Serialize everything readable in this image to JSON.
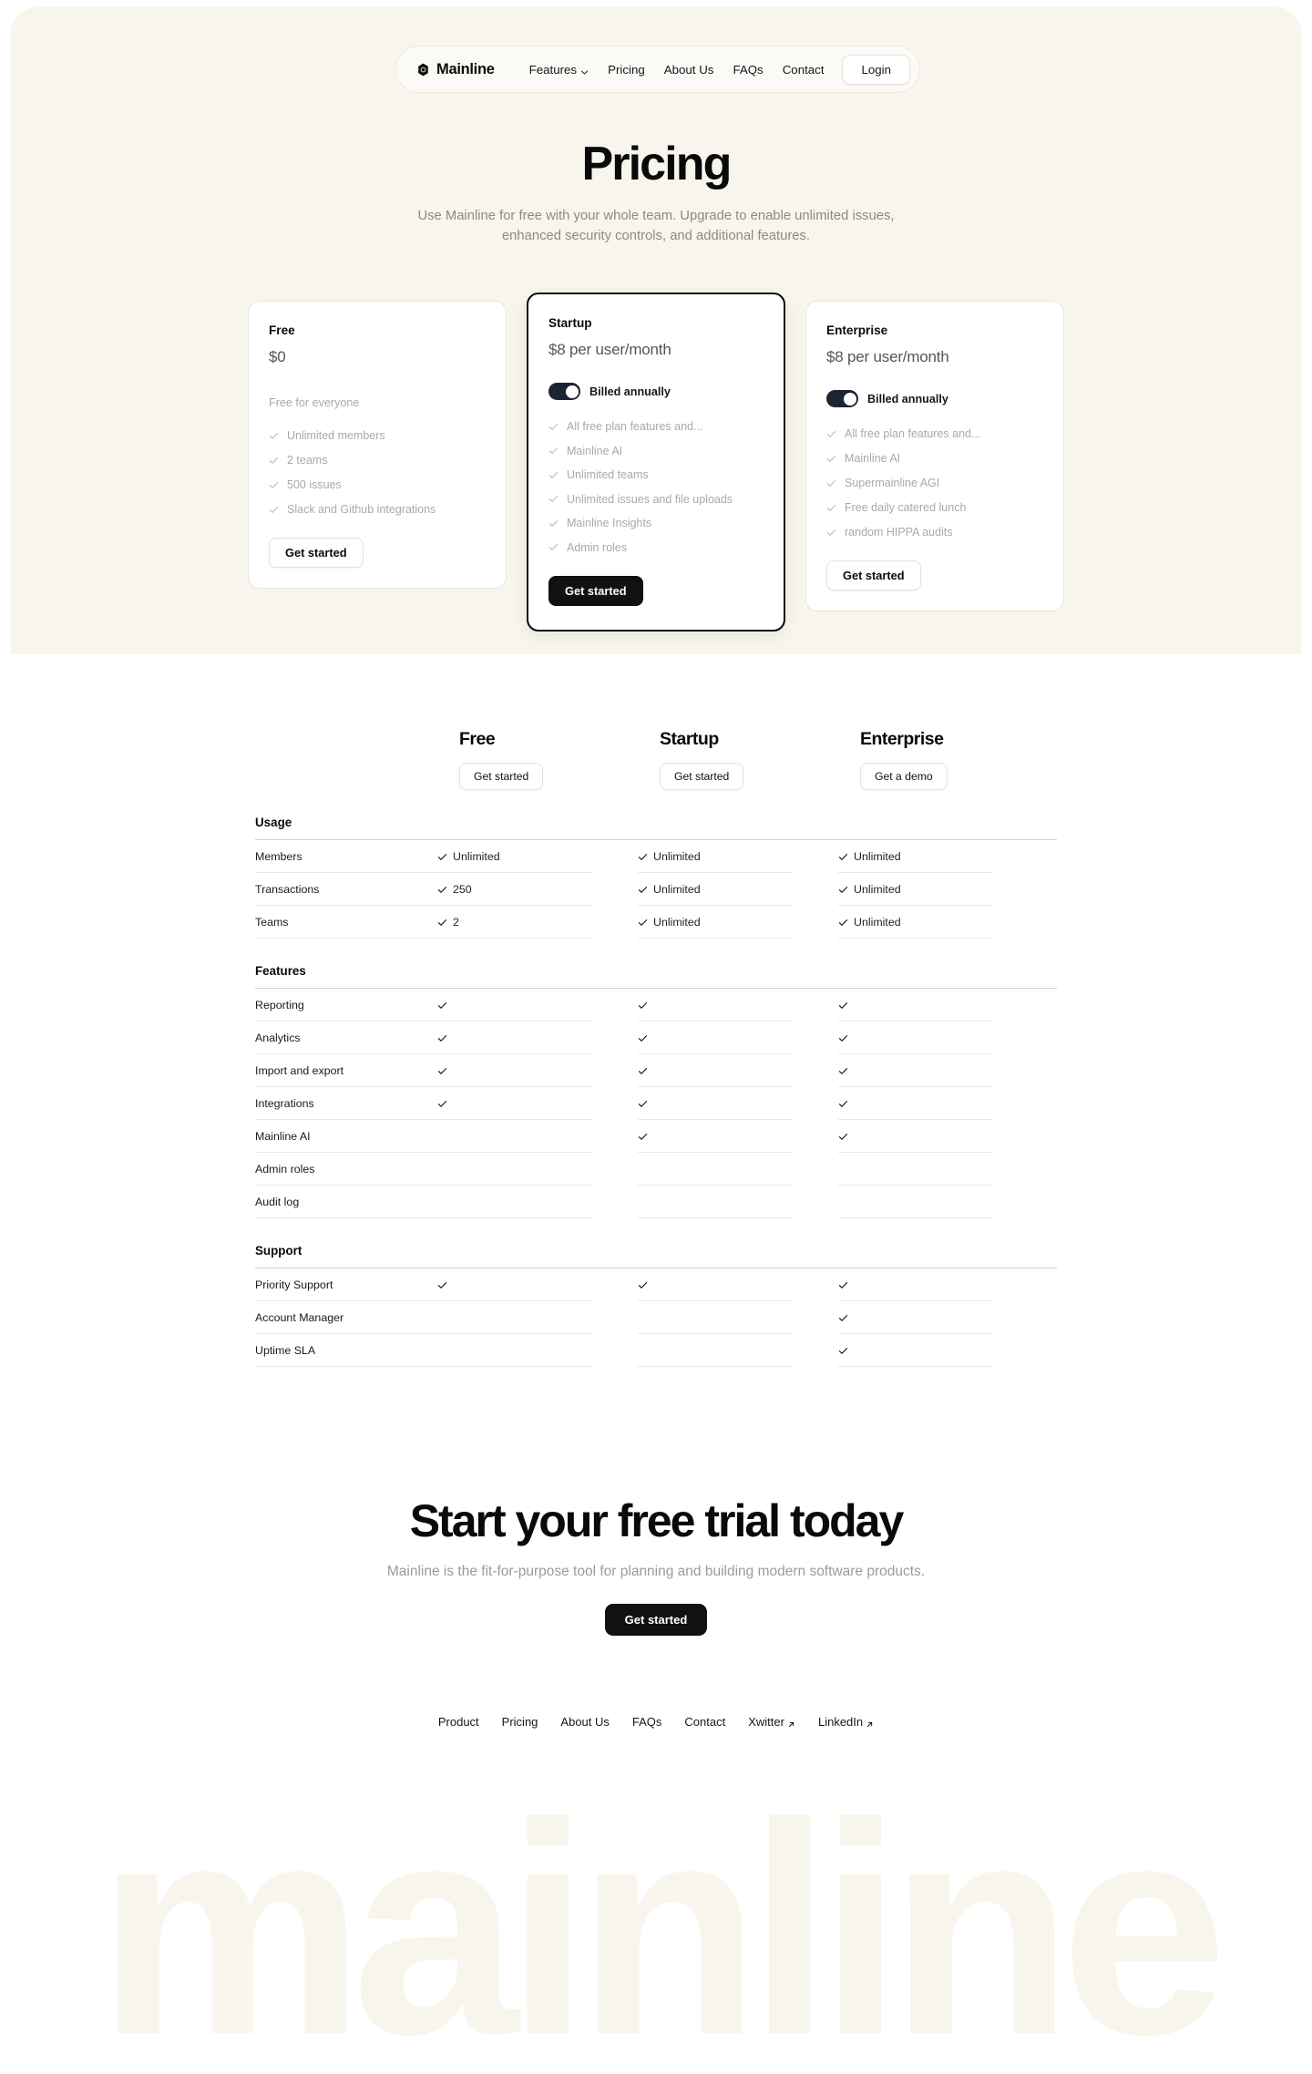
{
  "nav": {
    "brand": "Mainline",
    "brand_icon": "mainline-hexagon-logo-icon",
    "links": [
      {
        "label": "Features",
        "has_chevron": true
      },
      {
        "label": "Pricing",
        "has_chevron": false
      },
      {
        "label": "About Us",
        "has_chevron": false
      },
      {
        "label": "FAQs",
        "has_chevron": false
      },
      {
        "label": "Contact",
        "has_chevron": false
      }
    ],
    "login_label": "Login"
  },
  "hero": {
    "title": "Pricing",
    "subtitle": "Use Mainline for free with your whole team. Upgrade to enable unlimited issues, enhanced security controls, and additional features."
  },
  "plans": [
    {
      "name": "Free",
      "price": "$0",
      "note": "Free for everyone",
      "has_toggle": false,
      "toggle_label": "",
      "features": [
        "Unlimited members",
        "2 teams",
        "500 issues",
        "Slack and Github integrations"
      ],
      "cta": "Get started",
      "featured": false
    },
    {
      "name": "Startup",
      "price": "$8 per user/month",
      "note": "",
      "has_toggle": true,
      "toggle_label": "Billed annually",
      "features": [
        "All free plan features and...",
        "Mainline AI",
        "Unlimited teams",
        "Unlimited issues and file uploads",
        "Mainline Insights",
        "Admin roles"
      ],
      "cta": "Get started",
      "featured": true
    },
    {
      "name": "Enterprise",
      "price": "$8 per user/month",
      "note": "",
      "has_toggle": true,
      "toggle_label": "Billed annually",
      "features": [
        "All free plan features and...",
        "Mainline AI",
        "Supermainline AGI",
        "Free daily catered lunch",
        "random HIPPA audits"
      ],
      "cta": "Get started",
      "featured": false
    }
  ],
  "comparison": {
    "columns": [
      {
        "name": "Free",
        "cta": "Get started"
      },
      {
        "name": "Startup",
        "cta": "Get started"
      },
      {
        "name": "Enterprise",
        "cta": "Get a demo"
      }
    ],
    "sections": [
      {
        "title": "Usage",
        "rows": [
          {
            "label": "Members",
            "values": [
              "Unlimited",
              "Unlimited",
              "Unlimited"
            ]
          },
          {
            "label": "Transactions",
            "values": [
              "250",
              "Unlimited",
              "Unlimited"
            ]
          },
          {
            "label": "Teams",
            "values": [
              "2",
              "Unlimited",
              "Unlimited"
            ]
          }
        ]
      },
      {
        "title": "Features",
        "rows": [
          {
            "label": "Reporting",
            "values": [
              "check",
              "check",
              "check"
            ]
          },
          {
            "label": "Analytics",
            "values": [
              "check",
              "check",
              "check"
            ]
          },
          {
            "label": "Import and export",
            "values": [
              "check",
              "check",
              "check"
            ]
          },
          {
            "label": "Integrations",
            "values": [
              "check",
              "check",
              "check"
            ]
          },
          {
            "label": "Mainline AI",
            "values": [
              "",
              "check",
              "check"
            ]
          },
          {
            "label": "Admin roles",
            "values": [
              "",
              "",
              ""
            ]
          },
          {
            "label": "Audit log",
            "values": [
              "",
              "",
              ""
            ]
          }
        ]
      },
      {
        "title": "Support",
        "rows": [
          {
            "label": "Priority Support",
            "values": [
              "check",
              "check",
              "check"
            ]
          },
          {
            "label": "Account Manager",
            "values": [
              "",
              "",
              "check"
            ]
          },
          {
            "label": "Uptime SLA",
            "values": [
              "",
              "",
              "check"
            ]
          }
        ]
      }
    ]
  },
  "cta": {
    "title": "Start your free trial today",
    "subtitle": "Mainline is the fit-for-purpose tool for planning and building modern software products.",
    "button": "Get started"
  },
  "footer": {
    "links": [
      {
        "label": "Product",
        "external": false
      },
      {
        "label": "Pricing",
        "external": false
      },
      {
        "label": "About Us",
        "external": false
      },
      {
        "label": "FAQs",
        "external": false
      },
      {
        "label": "Contact",
        "external": false
      },
      {
        "label": "Xwitter",
        "external": true
      },
      {
        "label": "LinkedIn",
        "external": true
      }
    ]
  },
  "watermark": {
    "text": "mainline"
  },
  "colors": {
    "hero_bg": "#F7F5EC",
    "page_bg": "#FFFFFF",
    "ink": "#0A0A0A",
    "muted": "#A9A9A5",
    "toggle_on": "#1C2433",
    "watermark": "#F8F6EC"
  }
}
